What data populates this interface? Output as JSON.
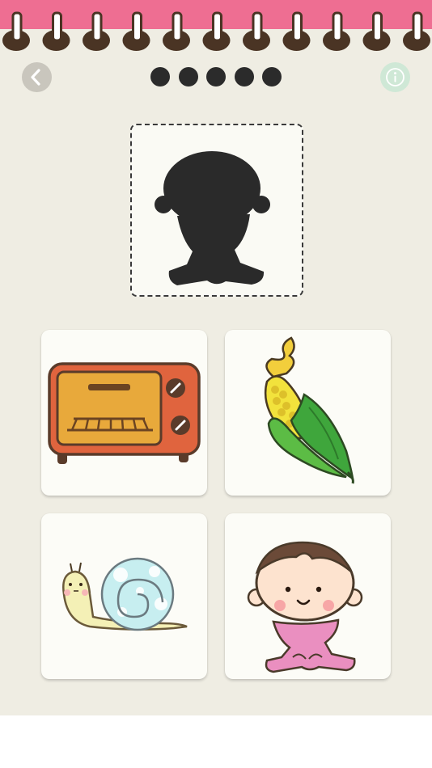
{
  "header": {
    "back_icon": "chevron-left-icon",
    "info_icon": "info-icon",
    "progress_total": 5,
    "progress_current": 0,
    "colors": {
      "strip": "#ee6e92",
      "ring": "#4a3424",
      "background": "#efede3"
    }
  },
  "puzzle": {
    "silhouette_icon": "baby-silhouette-icon",
    "choices": [
      {
        "icon": "toaster-oven-icon"
      },
      {
        "icon": "corn-icon"
      },
      {
        "icon": "snail-icon"
      },
      {
        "icon": "baby-icon"
      }
    ]
  }
}
